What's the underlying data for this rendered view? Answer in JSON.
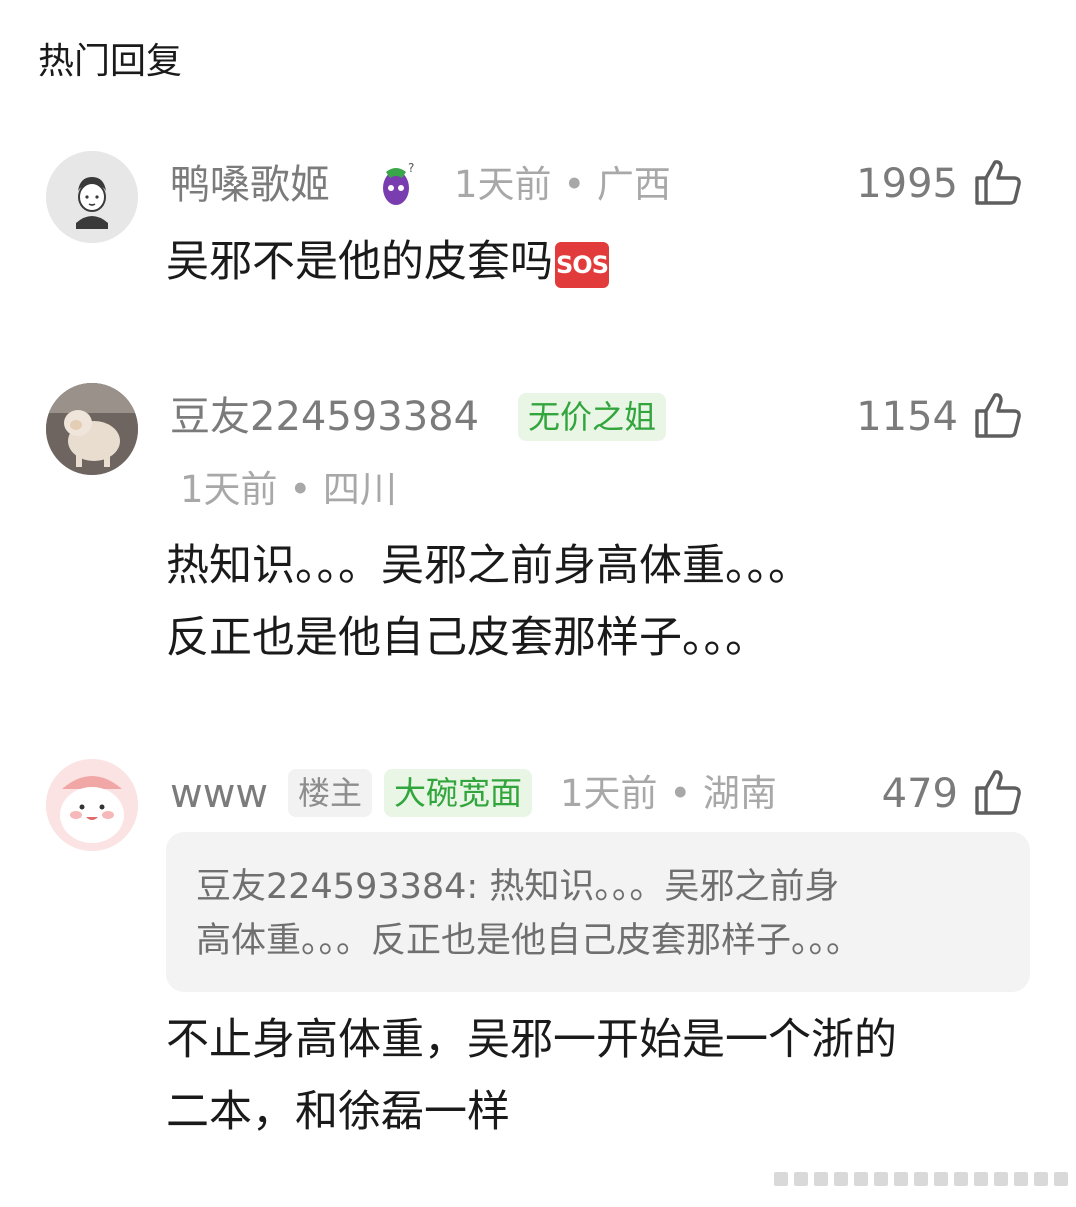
{
  "section_title": "热门回复",
  "comments": [
    {
      "username": "鸭嗓歌姬",
      "badge_icon": "eggplant-icon",
      "time": "1天前",
      "location": "广西",
      "likes": "1995",
      "content": "吴邪不是他的皮套吗",
      "emoji": "SOS"
    },
    {
      "username": "豆友224593384",
      "tag": "无价之姐",
      "time": "1天前",
      "location": "四川",
      "likes": "1154",
      "content_lines": [
        "热知识。。。吴邪之前身高体重。。。",
        "反正也是他自己皮套那样子。。。"
      ]
    },
    {
      "username": "www",
      "owner_tag": "楼主",
      "tag": "大碗宽面",
      "time": "1天前",
      "location": "湖南",
      "likes": "479",
      "quote_lines": [
        "豆友224593384: 热知识。。。吴邪之前身",
        "高体重。。。反正也是他自己皮套那样子。。。"
      ],
      "content_lines": [
        "不止身高体重，吴邪一开始是一个浙的",
        "二本，和徐磊一样"
      ]
    }
  ],
  "colors": {
    "tag_green_bg": "#e9f6e6",
    "tag_green_text": "#33a53d",
    "muted_text": "#a8a8a8",
    "sos_red": "#e23b3b"
  }
}
